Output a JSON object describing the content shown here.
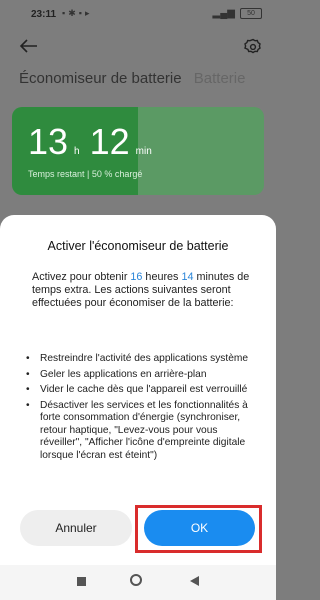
{
  "status_bar": {
    "time": "23:11",
    "battery": "50"
  },
  "tabs": {
    "active": "Économiseur de batterie",
    "inactive": "Batterie"
  },
  "card": {
    "hours": "13",
    "hours_unit": "h",
    "minutes": "12",
    "minutes_unit": "min",
    "subtitle": "Temps restant | 50 % chargé",
    "charge_fraction": 0.5
  },
  "dialog": {
    "title": "Activer l'économiseur de batterie",
    "intro_1": "Activez pour obtenir ",
    "intro_hours": "16",
    "intro_2": " heures ",
    "intro_minutes": "14",
    "intro_3": " minutes de temps extra. Les actions suivantes seront effectuées pour économiser de la batterie:",
    "bullet_symbol": "•",
    "items": [
      "Restreindre l'activité des applications système",
      "Geler les applications en arrière-plan",
      "Vider le cache dès que l'appareil est verrouillé",
      "Désactiver les services et les fonctionnalités à forte consommation d'énergie (synchroniser, retour haptique, \"Levez-vous pour vous réveiller\", \"Afficher l'icône d'empreinte digitale lorsque l'écran est éteint\")"
    ],
    "cancel_label": "Annuler",
    "ok_label": "OK"
  },
  "colors": {
    "accent": "#1a8cf0",
    "card_green": "#2f8b3e",
    "highlight_box": "#d92c2c"
  },
  "icons": [
    "back-arrow-icon",
    "gear-icon",
    "nav-recents-icon",
    "nav-home-icon",
    "nav-back-icon"
  ]
}
